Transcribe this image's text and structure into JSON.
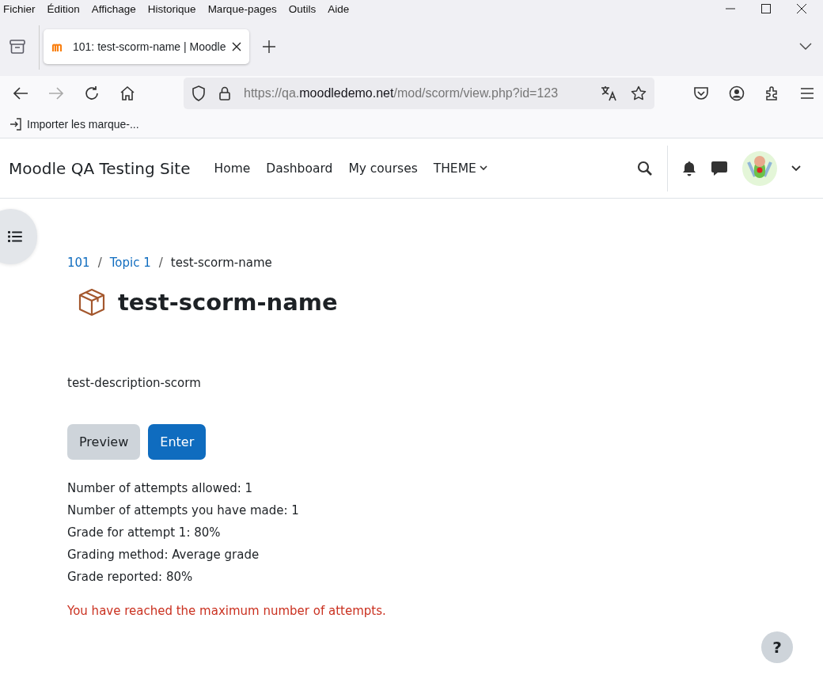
{
  "menu_bar": [
    "Fichier",
    "Édition",
    "Affichage",
    "Historique",
    "Marque-pages",
    "Outils",
    "Aide"
  ],
  "tabs": [
    {
      "title": "101: test-scorm-name | Moodle",
      "selected": true
    }
  ],
  "address_bar": {
    "url_parts": [
      {
        "text": "https://qa.",
        "kind": "dim"
      },
      {
        "text": "moodledemo.net",
        "kind": "domain"
      },
      {
        "text": "/mod/scorm/view.php?id=123",
        "kind": "dim"
      }
    ]
  },
  "bookmarks_bar": [
    "Importer les marque-..."
  ],
  "site": {
    "name": "Moodle QA Testing Site",
    "nav": [
      {
        "label": "Home",
        "has_menu": false
      },
      {
        "label": "Dashboard",
        "has_menu": false
      },
      {
        "label": "My courses",
        "has_menu": false
      },
      {
        "label": "THEME",
        "has_menu": true
      }
    ]
  },
  "breadcrumb": [
    {
      "text": "101",
      "kind": "link"
    },
    {
      "separator": "/",
      "text": "Topic 1",
      "kind": "link"
    },
    {
      "separator": "/",
      "text": "test-scorm-name",
      "kind": "current"
    }
  ],
  "page_title": "test-scorm-name",
  "description": "test-description-scorm",
  "buttons": [
    {
      "label": "Preview",
      "kind": "secondary"
    },
    {
      "label": "Enter",
      "kind": "primary"
    }
  ],
  "attempt_info": [
    "Number of attempts allowed: 1",
    "Number of attempts you have made: 1",
    "Grade for attempt 1: 80%",
    "Grading method: Average grade",
    "Grade reported: 80%"
  ],
  "warning": "You have reached the maximum number of attempts.",
  "help_button": "?"
}
